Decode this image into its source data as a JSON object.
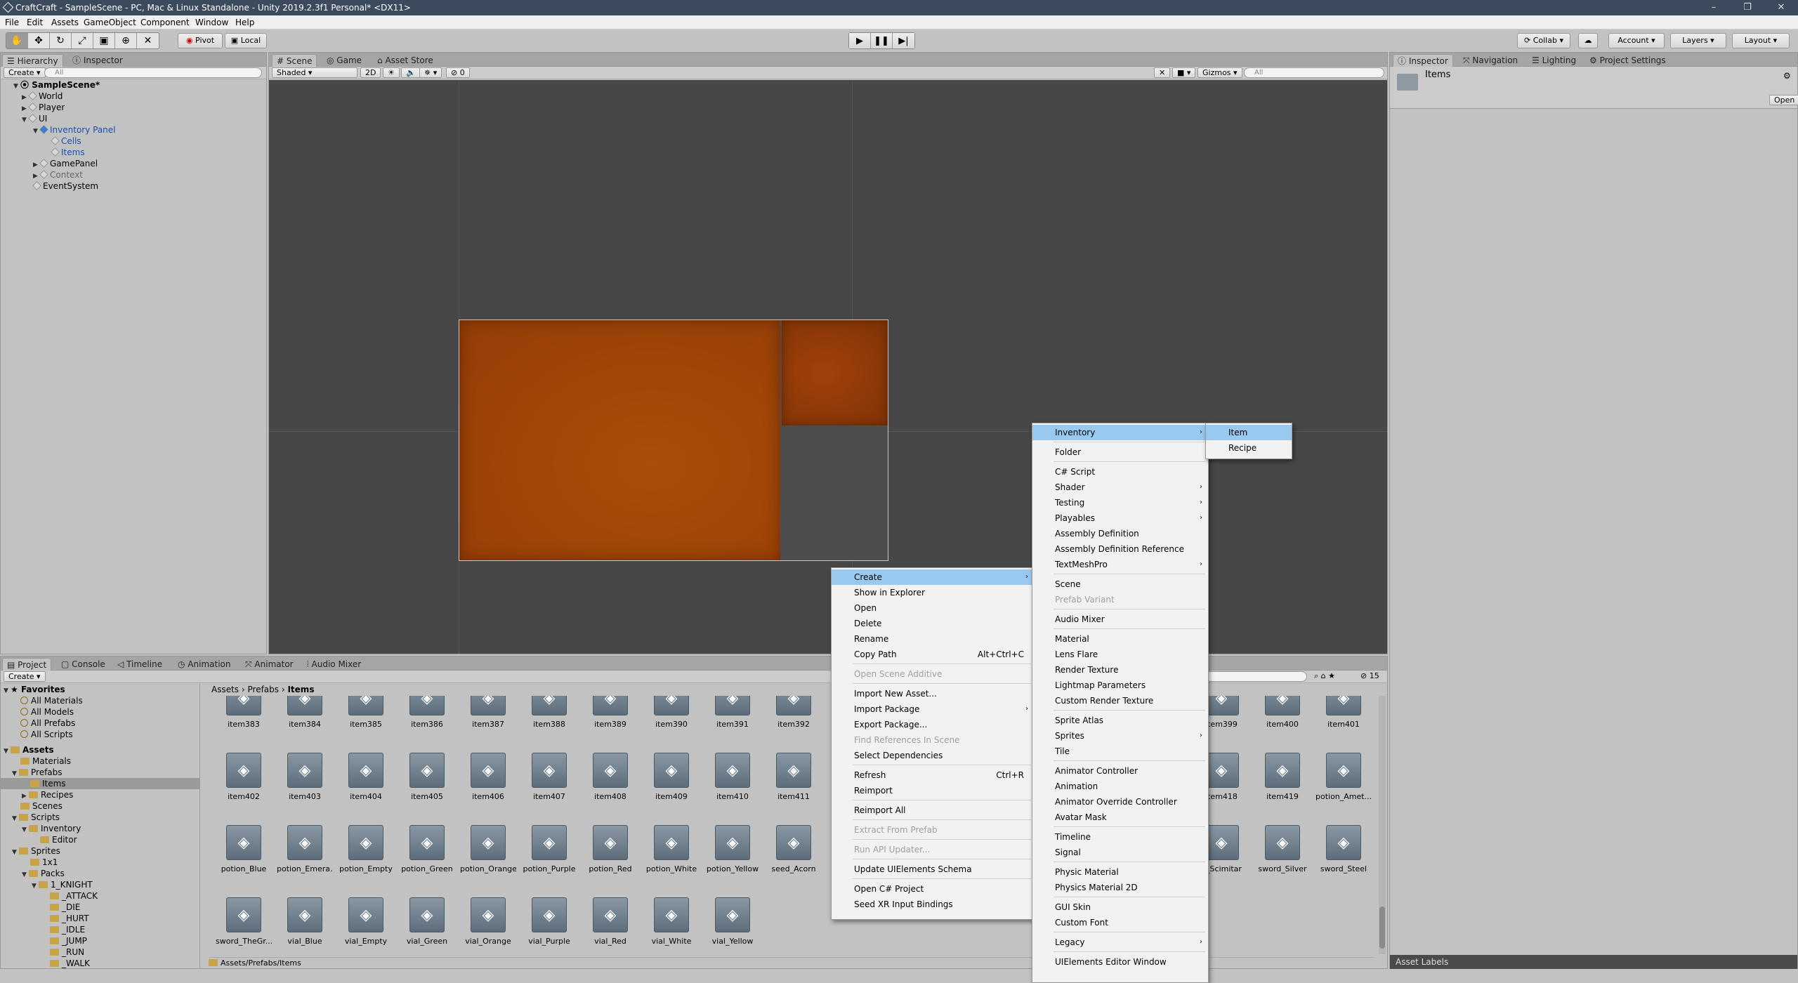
{
  "window": {
    "title": "CraftCraft - SampleScene - PC, Mac & Linux Standalone - Unity 2019.2.3f1 Personal* <DX11>"
  },
  "menu": [
    "File",
    "Edit",
    "Assets",
    "GameObject",
    "Component",
    "Window",
    "Help"
  ],
  "toolbar": {
    "pivot": "Pivot",
    "local": "Local",
    "collab": "Collab",
    "account": "Account",
    "layers": "Layers",
    "layout": "Layout"
  },
  "hierarchy": {
    "tab": "Hierarchy",
    "tab2": "Inspector",
    "create": "Create",
    "search": "All",
    "scene": "SampleScene*",
    "items": [
      "World",
      "Player",
      "UI",
      "Inventory Panel",
      "Cells",
      "Items",
      "GamePanel",
      "Context",
      "EventSystem"
    ]
  },
  "scene": {
    "tabs": [
      "Scene",
      "Game",
      "Asset Store"
    ],
    "shading": "Shaded",
    "mode2d": "2D",
    "gizmos": "Gizmos",
    "search": "All",
    "fx": "0"
  },
  "inspector": {
    "tabs": [
      "Inspector",
      "Navigation",
      "Lighting",
      "Project Settings"
    ],
    "title": "Items",
    "open": "Open",
    "labels": "Asset Labels"
  },
  "project": {
    "tabs": [
      "Project",
      "Console",
      "Timeline",
      "Animation",
      "Animator",
      "Audio Mixer"
    ],
    "create": "Create",
    "count": "15",
    "breadcrumb": [
      "Assets",
      "Prefabs",
      "Items"
    ],
    "footer": "Assets/Prefabs/Items",
    "tree": [
      "Favorites",
      "All Materials",
      "All Models",
      "All Prefabs",
      "All Scripts",
      "Assets",
      "Materials",
      "Prefabs",
      "Items",
      "Recipes",
      "Scenes",
      "Scripts",
      "Inventory",
      "Editor",
      "Sprites",
      "1x1",
      "Packs",
      "1_KNIGHT",
      "_ATTACK",
      "_DIE",
      "_HURT",
      "_IDLE",
      "_JUMP",
      "_RUN",
      "_WALK"
    ],
    "row1": [
      "item383",
      "item384",
      "item385",
      "item386",
      "item387",
      "item388",
      "item389",
      "item390",
      "item391",
      "item392"
    ],
    "row2": [
      "item402",
      "item403",
      "item404",
      "item405",
      "item406",
      "item407",
      "item408",
      "item409",
      "item410",
      "item411"
    ],
    "row3": [
      "potion_Blue",
      "potion_Emera...",
      "potion_Empty",
      "potion_Green",
      "potion_Orange",
      "potion_Purple",
      "potion_Red",
      "potion_White",
      "potion_Yellow",
      "seed_Acorn"
    ],
    "row4": [
      "sword_TheGr...",
      "vial_Blue",
      "vial_Empty",
      "vial_Green",
      "vial_Orange",
      "vial_Purple",
      "vial_Red",
      "vial_White",
      "vial_Yellow"
    ],
    "right1": [
      "item399",
      "item400",
      "item401"
    ],
    "right2": [
      "item418",
      "item419",
      "potion_Amet..."
    ],
    "right3": [
      "d_Scimitar",
      "sword_Silver",
      "sword_Steel"
    ]
  },
  "context_menu": {
    "items": [
      "Create",
      "Show in Explorer",
      "Open",
      "Delete",
      "Rename",
      "Copy Path",
      "Open Scene Additive",
      "Import New Asset...",
      "Import Package",
      "Export Package...",
      "Find References In Scene",
      "Select Dependencies",
      "Refresh",
      "Reimport",
      "Reimport All",
      "Extract From Prefab",
      "Run API Updater...",
      "Update UIElements Schema",
      "Open C# Project",
      "Seed XR Input Bindings"
    ],
    "copy_shortcut": "Alt+Ctrl+C",
    "refresh_shortcut": "Ctrl+R"
  },
  "create_menu": {
    "items": [
      "Inventory",
      "Folder",
      "C# Script",
      "Shader",
      "Testing",
      "Playables",
      "Assembly Definition",
      "Assembly Definition Reference",
      "TextMeshPro",
      "Scene",
      "Prefab Variant",
      "Audio Mixer",
      "Material",
      "Lens Flare",
      "Render Texture",
      "Lightmap Parameters",
      "Custom Render Texture",
      "Sprite Atlas",
      "Sprites",
      "Tile",
      "Animator Controller",
      "Animation",
      "Animator Override Controller",
      "Avatar Mask",
      "Timeline",
      "Signal",
      "Physic Material",
      "Physics Material 2D",
      "GUI Skin",
      "Custom Font",
      "Legacy",
      "UIElements Editor Window"
    ]
  },
  "inventory_menu": {
    "items": [
      "Item",
      "Recipe"
    ]
  },
  "colors": {
    "highlight": "#99c9ef",
    "scene_bg": "#474747",
    "panel_orange": "#a3480a"
  }
}
